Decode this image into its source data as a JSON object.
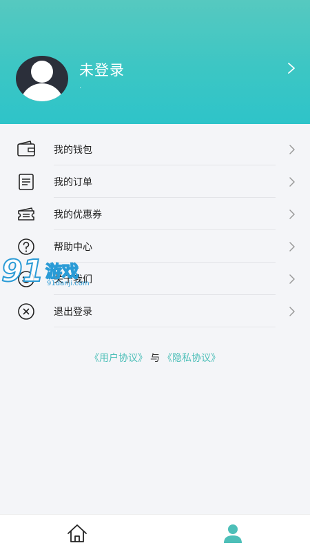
{
  "header": {
    "user_name": "未登录",
    "user_sub": "."
  },
  "menu": {
    "items": [
      {
        "label": "我的钱包",
        "icon": "wallet-icon"
      },
      {
        "label": "我的订单",
        "icon": "order-list-icon"
      },
      {
        "label": "我的优惠券",
        "icon": "coupon-icon"
      },
      {
        "label": "帮助中心",
        "icon": "help-icon"
      },
      {
        "label": "关于我们",
        "icon": "smile-icon"
      },
      {
        "label": "退出登录",
        "icon": "close-circle-icon"
      }
    ]
  },
  "agreements": {
    "user_agreement": "《用户协议》",
    "separator": "与",
    "privacy_agreement": "《隐私协议》"
  },
  "tabbar": {
    "home_icon": "home-icon",
    "profile_icon": "profile-icon",
    "active_color": "#4dbfb8"
  },
  "watermark": {
    "number": "91",
    "text": "游戏",
    "url": "91danji.com"
  },
  "colors": {
    "header_top": "#56c9c0",
    "header_bottom": "#2ec4c9",
    "link": "#4dbfb8",
    "background": "#f4f5f8"
  }
}
